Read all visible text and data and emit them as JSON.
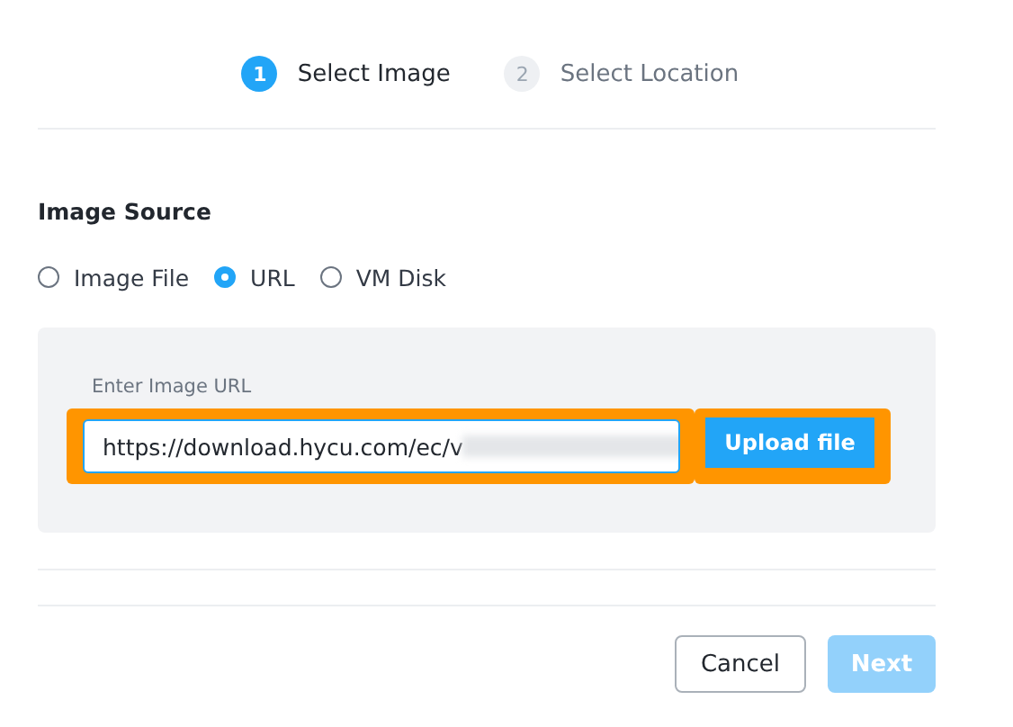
{
  "steps": [
    {
      "number": "1",
      "label": "Select Image",
      "selected": true
    },
    {
      "number": "2",
      "label": "Select Location",
      "selected": false
    }
  ],
  "image_source": {
    "title": "Image Source",
    "options": [
      {
        "label": "Image File",
        "selected": false
      },
      {
        "label": "URL",
        "selected": true
      },
      {
        "label": "VM Disk",
        "selected": false
      }
    ]
  },
  "url_panel": {
    "label": "Enter Image URL",
    "value": "https://download.hycu.com/ec/v",
    "highlighted": true,
    "upload_button": {
      "label": "Upload file",
      "highlighted": true
    }
  },
  "footer_buttons": [
    {
      "label": "Cancel",
      "kind": "secondary",
      "disabled": false
    },
    {
      "label": "Next",
      "kind": "primary",
      "disabled": true
    }
  ]
}
